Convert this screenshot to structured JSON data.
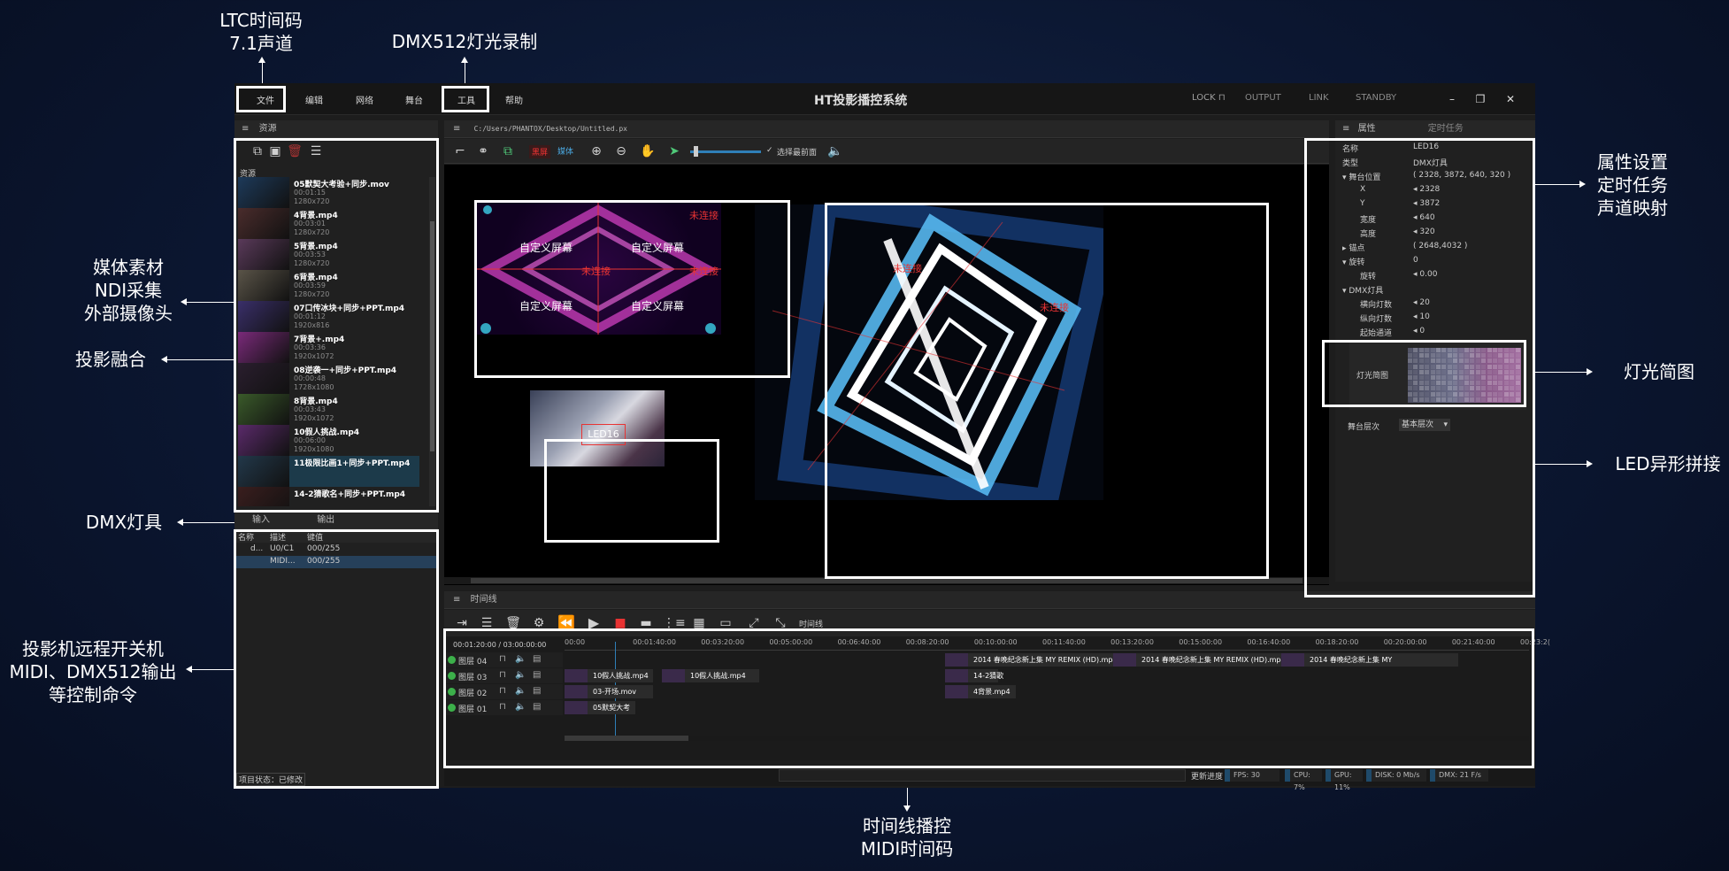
{
  "annotations": {
    "ltc": "LTC时间码",
    "ltc_channel": "7.1声道",
    "dmx_record": "DMX512灯光录制",
    "media_1": "媒体素材",
    "media_2": "NDI采集",
    "media_3": "外部摄像头",
    "blend": "投影融合",
    "dmx_fixture": "DMX灯具",
    "ctrl_1": "投影机远程开关机",
    "ctrl_2": "MIDI、DMX512输出",
    "ctrl_3": "等控制命令",
    "timeline_1": "时间线播控",
    "timeline_2": "MIDI时间码",
    "props_1": "属性设置",
    "props_2": "定时任务",
    "props_3": "声道映射",
    "light_map": "灯光简图",
    "led_stitch": "LED异形拼接"
  },
  "menu": {
    "file": "文件",
    "edit": "编辑",
    "network": "网络",
    "stage": "舞台",
    "tools": "工具",
    "help": "帮助"
  },
  "app_title": "HT投影播控系统",
  "status": {
    "lock": "LOCK",
    "output": "OUTPUT",
    "link": "LINK",
    "standby": "STANDBY"
  },
  "resources": {
    "tab": "资源",
    "root_label": "资源",
    "items": [
      {
        "name": "05默契大考验+同步.mov",
        "duration": "00:01:15",
        "res": "1280x720"
      },
      {
        "name": "4背景.mp4",
        "duration": "00:03:01",
        "res": "1280x720"
      },
      {
        "name": "5背景.mp4",
        "duration": "00:03:53",
        "res": "1280x720"
      },
      {
        "name": "6背景.mp4",
        "duration": "00:03:59",
        "res": "1280x720"
      },
      {
        "name": "07口传冰块+同步+PPT.mp4",
        "duration": "00:01:12",
        "res": "1920x816"
      },
      {
        "name": "7背景+.mp4",
        "duration": "00:03:36",
        "res": "1920x1072"
      },
      {
        "name": "08逆袭一+同步+PPT.mp4",
        "duration": "00:00:48",
        "res": "1728x1080"
      },
      {
        "name": "8背景.mp4",
        "duration": "00:03:43",
        "res": "1920x1072"
      },
      {
        "name": "10假人挑战.mp4",
        "duration": "00:06:00",
        "res": "1920x1080"
      },
      {
        "name": "11极限比画1+同步+PPT.mp4",
        "duration": "",
        "res": ""
      },
      {
        "name": "14-2猜歌名+同步+PPT.mp4",
        "duration": "",
        "res": ""
      }
    ]
  },
  "io": {
    "tab_in": "输入",
    "tab_out": "输出",
    "col_name": "名称",
    "col_desc": "描述",
    "col_key": "键值",
    "rows": [
      {
        "name": "d...",
        "desc": "U0/C1",
        "key": "000/255"
      },
      {
        "name": "",
        "desc": "MIDI...",
        "key": "000/255"
      }
    ],
    "project_status": "项目状态：已修改"
  },
  "stage": {
    "path": "C:/Users/PHANTOX/Desktop/Untitled.px",
    "btn_blackout": "黑屏",
    "btn_media": "媒体",
    "bring_front": "选择最前面",
    "custom_screen": "自定义屏幕",
    "unconnected": "未连接",
    "led_label": "LED16"
  },
  "properties": {
    "tab_props": "属性",
    "tab_tasks": "定时任务",
    "rows": [
      {
        "key": "名称",
        "value": "LED16",
        "indent": 0
      },
      {
        "key": "类型",
        "value": "DMX灯具",
        "indent": 0
      },
      {
        "key": "▾ 舞台位置",
        "value": "( 2328, 3872, 640, 320 )",
        "indent": 0
      },
      {
        "key": "X",
        "value": "◂ 2328",
        "indent": 1
      },
      {
        "key": "Y",
        "value": "◂ 3872",
        "indent": 1
      },
      {
        "key": "宽度",
        "value": "◂ 640",
        "indent": 1
      },
      {
        "key": "高度",
        "value": "◂ 320",
        "indent": 1
      },
      {
        "key": "▸ 锚点",
        "value": "( 2648,4032 )",
        "indent": 0
      },
      {
        "key": "▾ 旋转",
        "value": "0",
        "indent": 0
      },
      {
        "key": "旋转",
        "value": "◂ 0.00",
        "indent": 1
      },
      {
        "key": "▾ DMX灯具",
        "value": "",
        "indent": 0
      },
      {
        "key": "横向灯数",
        "value": "◂ 20",
        "indent": 1
      },
      {
        "key": "纵向灯数",
        "value": "◂ 10",
        "indent": 1
      },
      {
        "key": "起始通道",
        "value": "◂ 0",
        "indent": 1
      }
    ],
    "light_map_label": "灯光简图",
    "stage_layer_label": "舞台层次",
    "stage_layer_value": "基本层次"
  },
  "timeline": {
    "tab": "时间线",
    "timeline_label": "时间线",
    "time_display": "00:01:20:00 / 03:00:00:00",
    "ruler": [
      "00:00",
      "00:01:40:00",
      "00:03:20:00",
      "00:05:00:00",
      "00:06:40:00",
      "00:08:20:00",
      "00:10:00:00",
      "00:11:40:00",
      "00:13:20:00",
      "00:15:00:00",
      "00:16:40:00",
      "00:18:20:00",
      "00:20:00:00",
      "00:21:40:00",
      "00:23:2("
    ],
    "tracks": [
      {
        "label": "图层 04",
        "clips": [
          "2014 春晚纪念新上集 MY REMIX (HD).mp4",
          "2014 春晚纪念新上集 MY REMIX (HD).mp4",
          "2014 春晚纪念新上集 MY"
        ]
      },
      {
        "label": "图层 03",
        "clips": [
          "10假人挑战.mp4",
          "10假人挑战.mp4",
          "14-2猜歌"
        ]
      },
      {
        "label": "图层 02",
        "clips": [
          "03-开场.mov",
          "4背景.mp4"
        ]
      },
      {
        "label": "图层 01",
        "clips": [
          "05默契大考"
        ]
      }
    ]
  },
  "statusbar": {
    "update_btn": "更新进度",
    "fps": "FPS: 30",
    "cpu": "CPU: 7%",
    "gpu": "GPU: 11%",
    "disk": "DISK: 0 Mb/s",
    "dmx": "DMX: 21 F/s"
  },
  "colors": {
    "accent_blue": "#2f7fb8",
    "highlight_white": "#ffffff",
    "red": "#e83333"
  }
}
